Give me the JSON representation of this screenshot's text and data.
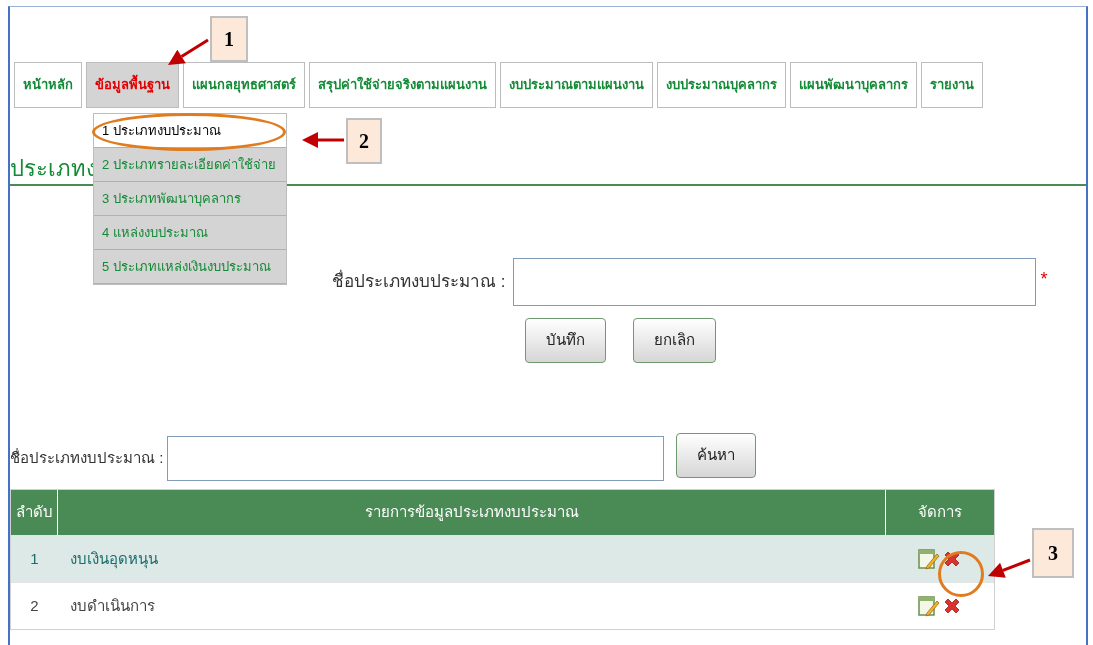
{
  "tabs": [
    {
      "label": "หน้าหลัก",
      "selected": false
    },
    {
      "label": "ข้อมูลพื้นฐาน",
      "selected": true
    },
    {
      "label": "แผนกลยุทธศาสตร์",
      "selected": false
    },
    {
      "label": "สรุปค่าใช้จ่ายจริงตามแผนงาน",
      "selected": false
    },
    {
      "label": "งบประมาณตามแผนงาน",
      "selected": false
    },
    {
      "label": "งบประมาณบุคลากร",
      "selected": false
    },
    {
      "label": "แผนพัฒนาบุคลากร",
      "selected": false
    },
    {
      "label": "รายงาน",
      "selected": false
    }
  ],
  "dropdown": [
    {
      "label": "1 ประเภทงบประมาณ",
      "selected": true
    },
    {
      "label": "2 ประเภทรายละเอียดค่าใช้จ่าย",
      "selected": false
    },
    {
      "label": "3 ประเภทพัฒนาบุคลากร",
      "selected": false
    },
    {
      "label": "4 แหล่งงบประมาณ",
      "selected": false
    },
    {
      "label": "5 ประเภทแหล่งเงินงบประมาณ",
      "selected": false
    }
  ],
  "page_title": "ประเภทง",
  "form": {
    "label": "ชื่อประเภทงบประมาณ :",
    "required_mark": "*",
    "buttons": [
      "บันทึก",
      "ยกเลิก"
    ]
  },
  "search": {
    "label": "ชื่อประเภทงบประมาณ :",
    "button": "ค้นหา"
  },
  "table": {
    "columns": [
      "ลำดับ",
      "รายการข้อมูลประเภทงบประมาณ",
      "จัดการ"
    ],
    "rows": [
      {
        "index": "1",
        "name": "งบเงินอุดหนุน",
        "selected": true
      },
      {
        "index": "2",
        "name": "งบดำเนินการ",
        "selected": false
      }
    ]
  },
  "callouts": [
    "1",
    "2",
    "3"
  ]
}
